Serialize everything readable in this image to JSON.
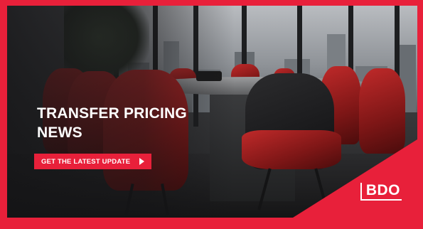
{
  "banner": {
    "headline": "TRANSFER PRICING NEWS",
    "cta_label": "GET THE LATEST UPDATE",
    "logo_text": "BDO"
  },
  "colors": {
    "brand_red": "#e8203a",
    "text": "#ffffff"
  },
  "icons": {
    "cta_arrow": "play-arrow-icon"
  }
}
